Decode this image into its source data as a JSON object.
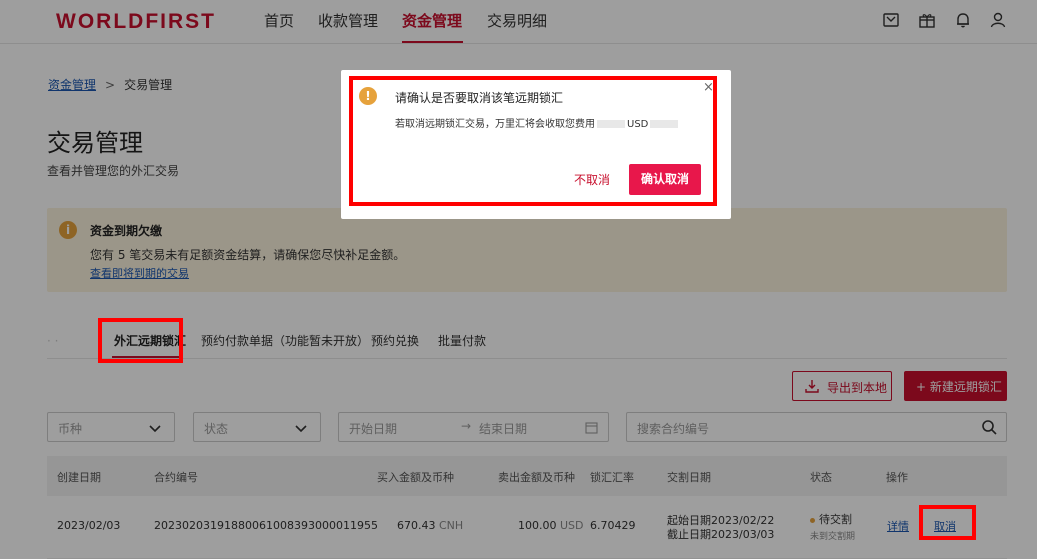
{
  "brand": {
    "logo": "WORLDFIRST",
    "accent": "#c8102e"
  },
  "nav": {
    "items": [
      {
        "label": "首页"
      },
      {
        "label": "收款管理"
      },
      {
        "label": "资金管理",
        "active": true
      },
      {
        "label": "交易明细"
      }
    ],
    "icons": [
      "wallet-icon",
      "gift-icon",
      "bell-icon",
      "user-icon"
    ]
  },
  "breadcrumb": {
    "parent": "资金管理",
    "separator": ">",
    "current": "交易管理"
  },
  "page": {
    "title": "交易管理",
    "subtitle": "查看并管理您的外汇交易"
  },
  "alert": {
    "title": "资金到期欠缴",
    "text": "您有 5 笔交易未有足额资金结算，请确保您尽快补足金额。",
    "link": "查看即将到期的交易"
  },
  "tabs": {
    "items": [
      {
        "label": "外汇远期锁汇",
        "active": true
      },
      {
        "label": "预约付款单据（功能暂未开放）"
      },
      {
        "label": "预约兑换"
      },
      {
        "label": "批量付款"
      }
    ]
  },
  "actions": {
    "export": "导出到本地",
    "new": "+ 新建远期锁汇"
  },
  "filters": {
    "currency_placeholder": "币种",
    "status_placeholder": "状态",
    "start_date_placeholder": "开始日期",
    "date_arrow": "→",
    "end_date_placeholder": "结束日期",
    "search_placeholder": "搜索合约编号"
  },
  "table": {
    "headers": [
      "创建日期",
      "合约编号",
      "买入金额及币种",
      "卖出金额及币种",
      "锁汇汇率",
      "交割日期",
      "状态",
      "操作"
    ],
    "rows": [
      {
        "created": "2023/02/03",
        "contract": "20230203191880061008393000011955",
        "buy_amount": "670.43",
        "buy_currency": "CNH",
        "sell_amount": "100.00",
        "sell_currency": "USD",
        "rate": "6.70429",
        "delivery_start": "起始日期2023/02/22",
        "delivery_end": "截止日期2023/03/03",
        "status": "待交割",
        "status_sub": "未到交割期",
        "action_detail": "详情",
        "action_cancel": "取消"
      }
    ]
  },
  "modal": {
    "title": "请确认是否要取消该笔远期锁汇",
    "text_before": "若取消远期锁汇交易，万里汇将会收取您费用",
    "text_currency": "USD",
    "close": "×",
    "cancel_label": "不取消",
    "confirm_label": "确认取消"
  }
}
